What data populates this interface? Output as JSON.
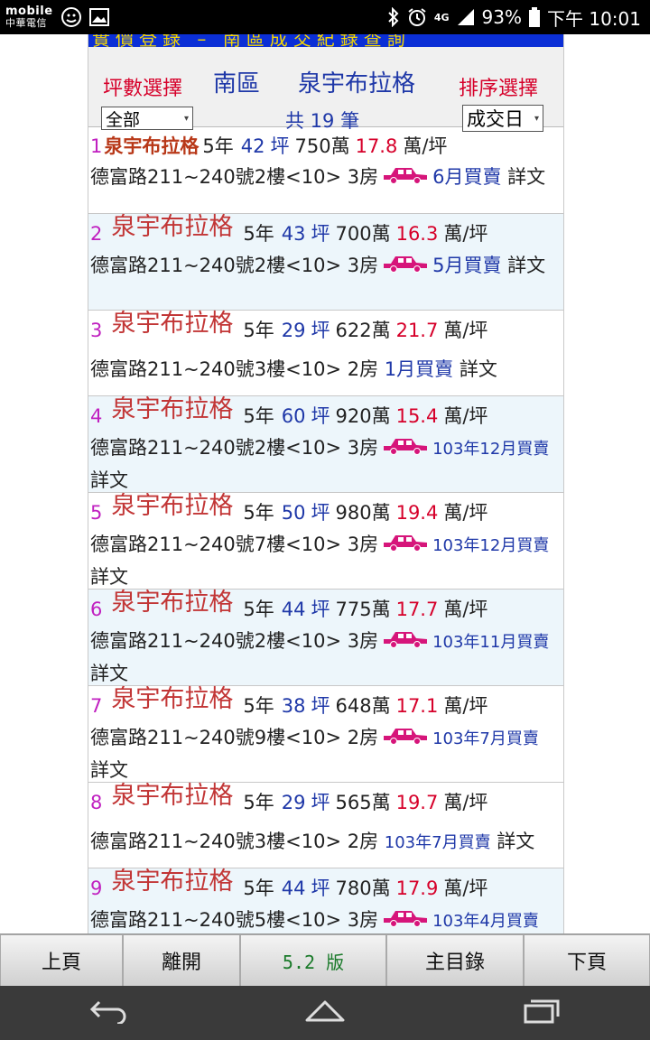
{
  "status": {
    "carrier_top": "mobile",
    "carrier_bottom": "中華電信",
    "network": "4G",
    "battery": "93%",
    "time": "下午 10:01"
  },
  "header": {
    "banner": "實價登錄 – 南區成交紀錄查詢",
    "size_label": "坪數選擇",
    "district": "南區",
    "building": "泉宇布拉格",
    "sort_label": "排序選擇",
    "size_value": "全部",
    "count": "共 19 筆",
    "sort_value": "成交日"
  },
  "listings": [
    {
      "num": "1",
      "name": "泉宇布拉格",
      "age": "5年",
      "size": "42",
      "size_unit": "坪",
      "price": "750萬",
      "unit_price": "17.8",
      "unit": "萬/坪",
      "address": "德富路211~240號2樓<10> 3房",
      "date": "6月買賣",
      "detail": "詳文"
    },
    {
      "num": "2",
      "name": "泉宇布拉格",
      "age": "5年",
      "size": "43",
      "size_unit": "坪",
      "price": "700萬",
      "unit_price": "16.3",
      "unit": "萬/坪",
      "address": "德富路211~240號2樓<10> 3房",
      "date": "5月買賣",
      "detail": "詳文"
    },
    {
      "num": "3",
      "name": "泉宇布拉格",
      "age": "5年",
      "size": "29",
      "size_unit": "坪",
      "price": "622萬",
      "unit_price": "21.7",
      "unit": "萬/坪",
      "address": "德富路211~240號3樓<10> 2房",
      "date": "1月買賣",
      "detail": "詳文"
    },
    {
      "num": "4",
      "name": "泉宇布拉格",
      "age": "5年",
      "size": "60",
      "size_unit": "坪",
      "price": "920萬",
      "unit_price": "15.4",
      "unit": "萬/坪",
      "address": "德富路211~240號2樓<10> 3房",
      "date": "103年12月買賣",
      "detail": "詳文"
    },
    {
      "num": "5",
      "name": "泉宇布拉格",
      "age": "5年",
      "size": "50",
      "size_unit": "坪",
      "price": "980萬",
      "unit_price": "19.4",
      "unit": "萬/坪",
      "address": "德富路211~240號7樓<10> 3房",
      "date": "103年12月買賣",
      "detail": "詳文"
    },
    {
      "num": "6",
      "name": "泉宇布拉格",
      "age": "5年",
      "size": "44",
      "size_unit": "坪",
      "price": "775萬",
      "unit_price": "17.7",
      "unit": "萬/坪",
      "address": "德富路211~240號2樓<10> 3房",
      "date": "103年11月買賣",
      "detail": "詳文"
    },
    {
      "num": "7",
      "name": "泉宇布拉格",
      "age": "5年",
      "size": "38",
      "size_unit": "坪",
      "price": "648萬",
      "unit_price": "17.1",
      "unit": "萬/坪",
      "address": "德富路211~240號9樓<10> 2房",
      "date": "103年7月買賣",
      "detail": "詳文"
    },
    {
      "num": "8",
      "name": "泉宇布拉格",
      "age": "5年",
      "size": "29",
      "size_unit": "坪",
      "price": "565萬",
      "unit_price": "19.7",
      "unit": "萬/坪",
      "address": "德富路211~240號3樓<10> 2房",
      "date": "103年7月買賣",
      "detail": "詳文"
    },
    {
      "num": "9",
      "name": "泉宇布拉格",
      "age": "5年",
      "size": "44",
      "size_unit": "坪",
      "price": "780萬",
      "unit_price": "17.9",
      "unit": "萬/坪",
      "address": "德富路211~240號5樓<10> 3房",
      "date": "103年4月買賣",
      "detail": "詳文"
    }
  ],
  "toolbar": {
    "prev": "上頁",
    "leave": "離開",
    "version": "5.2 版",
    "menu": "主目錄",
    "next": "下頁"
  },
  "colors": {
    "accent_blue": "#1f38a8",
    "price_red": "#d6002a",
    "car_magenta": "#d6157a",
    "index_magenta": "#c020c0"
  }
}
